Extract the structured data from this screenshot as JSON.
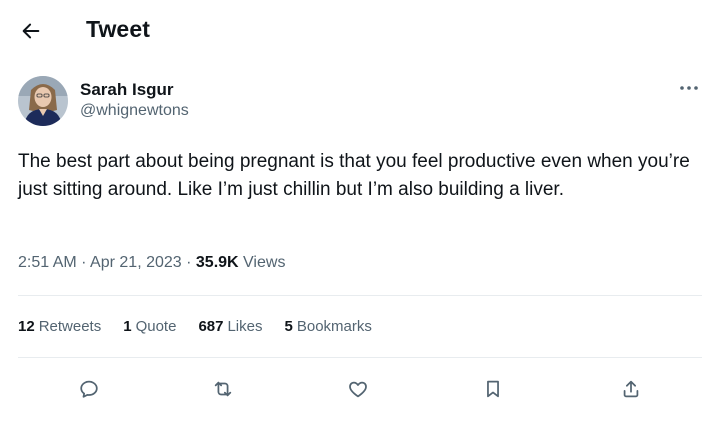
{
  "header": {
    "title": "Tweet",
    "back_icon": "arrow-left-icon"
  },
  "author": {
    "display_name": "Sarah Isgur",
    "handle": "@whignewtons",
    "more_icon": "more-horizontal-icon"
  },
  "tweet": {
    "text": "The best part about being pregnant is that you feel productive even when you’re just sitting around. Like I’m just chillin but I’m also building a liver.",
    "time": "2:51 AM",
    "date": "Apr 21, 2023",
    "views_count": "35.9K",
    "views_label": "Views"
  },
  "stats": {
    "retweets": {
      "count": "12",
      "label": "Retweets"
    },
    "quotes": {
      "count": "1",
      "label": "Quote"
    },
    "likes": {
      "count": "687",
      "label": "Likes"
    },
    "bookmarks": {
      "count": "5",
      "label": "Bookmarks"
    }
  },
  "actions": [
    "reply-icon",
    "retweet-icon",
    "like-icon",
    "bookmark-icon",
    "share-icon"
  ],
  "colors": {
    "text": "#0f1419",
    "secondary": "#536471",
    "divider": "#e8ecef"
  }
}
